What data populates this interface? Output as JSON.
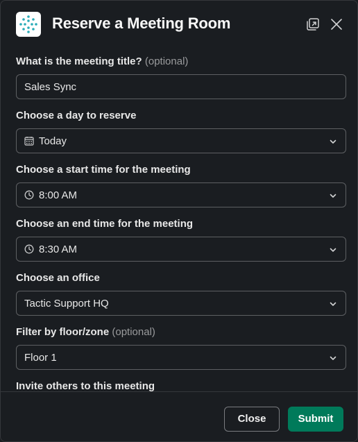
{
  "modal": {
    "title": "Reserve a Meeting Room",
    "logo_icon": "tactic-dots-logo",
    "expand_icon": "open-in-window-icon",
    "close_icon": "close-icon"
  },
  "fields": {
    "title": {
      "label": "What is the meeting title?",
      "optional": "(optional)",
      "value": "Sales Sync"
    },
    "day": {
      "label": "Choose a day to reserve",
      "value": "Today",
      "icon": "calendar-icon"
    },
    "start_time": {
      "label": "Choose a start time for the meeting",
      "value": "8:00 AM",
      "icon": "clock-icon"
    },
    "end_time": {
      "label": "Choose an end time for the meeting",
      "value": "8:30 AM",
      "icon": "clock-icon"
    },
    "office": {
      "label": "Choose an office",
      "value": "Tactic Support HQ"
    },
    "floor": {
      "label": "Filter by floor/zone",
      "optional": "(optional)",
      "value": "Floor 1"
    },
    "invite": {
      "label": "Invite others to this meeting"
    }
  },
  "footer": {
    "close_label": "Close",
    "submit_label": "Submit"
  },
  "colors": {
    "background": "#1a1d21",
    "border": "#5e6063",
    "submit": "#007a5a",
    "logo_accent": "#2bacb8"
  }
}
